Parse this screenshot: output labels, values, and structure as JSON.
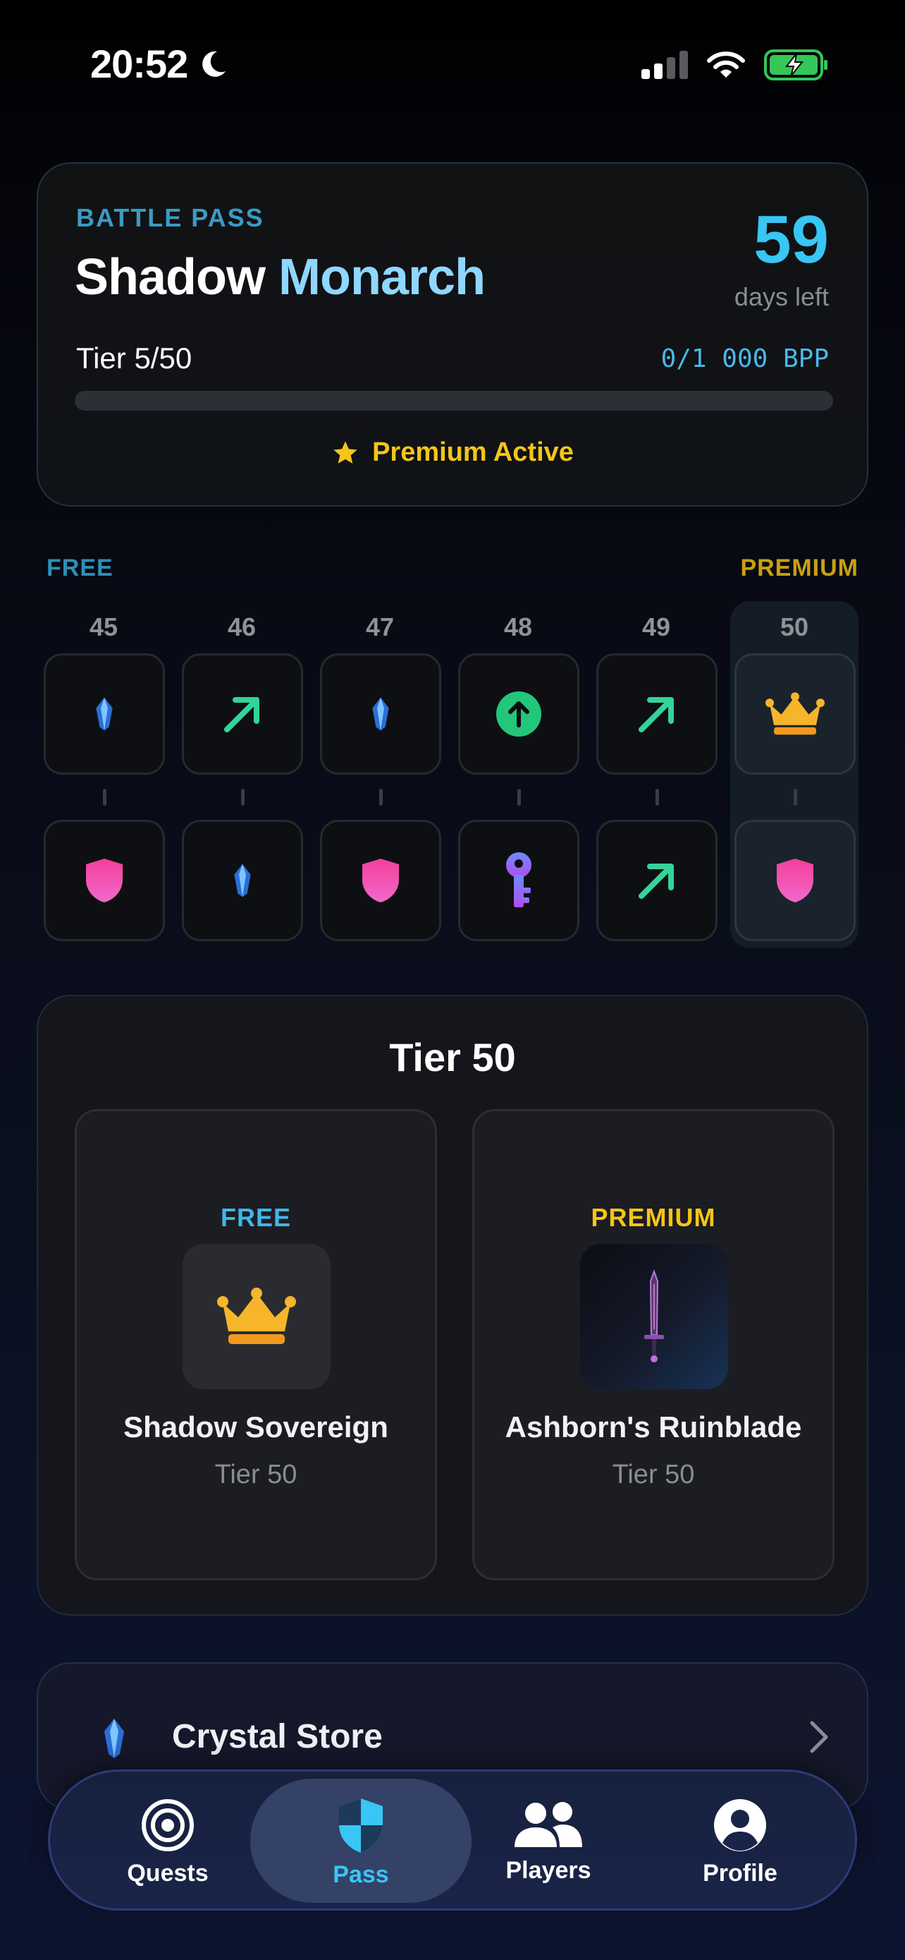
{
  "status_bar": {
    "time": "20:52",
    "icons": [
      "moon-icon",
      "signal-icon",
      "wifi-icon",
      "battery-charging-icon"
    ]
  },
  "battle_pass": {
    "label": "BATTLE PASS",
    "title_part1": "Shadow",
    "title_part2": "Monarch",
    "days_left_value": "59",
    "days_left_label": "days left",
    "tier_text": "Tier 5/50",
    "bpp_text": "0/1 000 BPP",
    "progress_fraction": 0,
    "premium_status": "Premium Active",
    "colors": {
      "accent": "#38c6f4",
      "premium": "#f5c518"
    }
  },
  "track": {
    "free_label": "FREE",
    "premium_label": "PREMIUM",
    "tiers": [
      {
        "number": "45",
        "free_icon": "crystal-icon",
        "premium_icon": "shield-icon"
      },
      {
        "number": "46",
        "free_icon": "arrow-up-right-icon",
        "premium_icon": "crystal-icon"
      },
      {
        "number": "47",
        "free_icon": "crystal-icon",
        "premium_icon": "shield-icon"
      },
      {
        "number": "48",
        "free_icon": "arrow-up-circle-icon",
        "premium_icon": "key-icon"
      },
      {
        "number": "49",
        "free_icon": "arrow-up-right-icon",
        "premium_icon": "arrow-up-right-icon"
      },
      {
        "number": "50",
        "free_icon": "crown-icon",
        "premium_icon": "shield-icon",
        "highlighted": true
      }
    ]
  },
  "tier_detail": {
    "title": "Tier 50",
    "free": {
      "kind": "FREE",
      "name": "Shadow Sovereign",
      "tier": "Tier 50",
      "icon": "crown-icon"
    },
    "premium": {
      "kind": "PREMIUM",
      "name": "Ashborn's Ruinblade",
      "tier": "Tier 50",
      "icon": "sword-icon"
    }
  },
  "store": {
    "title": "Crystal Store",
    "icon": "crystal-icon"
  },
  "tabbar": {
    "tabs": [
      {
        "label": "Quests",
        "icon": "target-icon"
      },
      {
        "label": "Pass",
        "icon": "shield-icon",
        "active": true
      },
      {
        "label": "Players",
        "icon": "users-icon"
      },
      {
        "label": "Profile",
        "icon": "person-icon"
      }
    ]
  }
}
